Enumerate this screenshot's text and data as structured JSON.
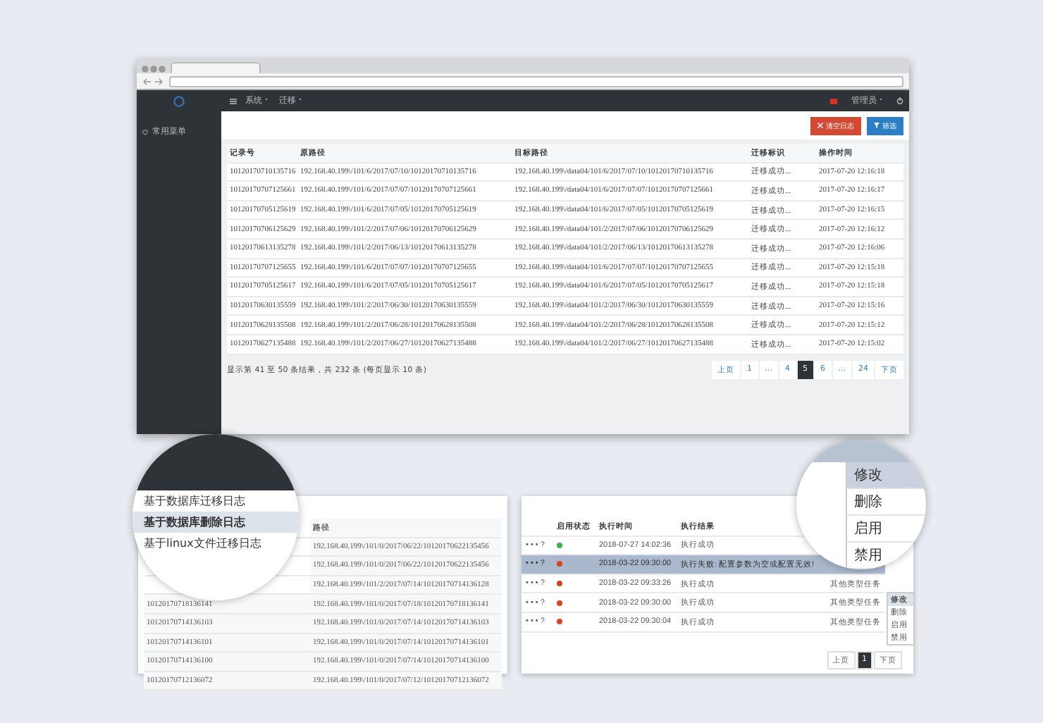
{
  "browser": {
    "menus": [
      "系统",
      "迁移"
    ],
    "user": "管理员",
    "sidebar": {
      "items": [
        {
          "label": "常用菜单"
        }
      ]
    },
    "toolbar": {
      "buttons": [
        {
          "label": "清空日志",
          "kind": "danger"
        },
        {
          "label": "筛选",
          "kind": "primary"
        }
      ]
    },
    "table": {
      "columns": [
        "记录号",
        "原路径",
        "目标路径",
        "迁移标识",
        "操作时间"
      ],
      "rows": [
        [
          "10120170710135716",
          "192.168.40.199\\/101/6/2017/07/10/10120170710135716",
          "192.168.40.199\\/data04/101/6/2017/07/10/10120170710135716",
          "迁移成功...",
          "2017-07-20 12:16:18"
        ],
        [
          "10120170707125661",
          "192.168.40.199\\/101/6/2017/07/07/10120170707125661",
          "192.168.40.199\\/data04/101/6/2017/07/07/10120170707125661",
          "迁移成功...",
          "2017-07-20 12:16:17"
        ],
        [
          "10120170705125619",
          "192.168.40.199\\/101/6/2017/07/05/10120170705125619",
          "192.168.40.199\\/data04/101/6/2017/07/05/10120170705125619",
          "迁移成功...",
          "2017-07-20 12:16:15"
        ],
        [
          "10120170706125629",
          "192.168.40.199\\/101/2/2017/07/06/10120170706125629",
          "192.168.40.199\\/data04/101/2/2017/07/06/10120170706125629",
          "迁移成功...",
          "2017-07-20 12:16:12"
        ],
        [
          "10120170613135278",
          "192.168.40.199\\/101/2/2017/06/13/10120170613135278",
          "192.168.40.199\\/data04/101/2/2017/06/13/10120170613135278",
          "迁移成功...",
          "2017-07-20 12:16:06"
        ],
        [
          "10120170707125655",
          "192.168.40.199\\/101/6/2017/07/07/10120170707125655",
          "192.168.40.199\\/data04/101/6/2017/07/07/10120170707125655",
          "迁移成功...",
          "2017-07-20 12:15:18"
        ],
        [
          "10120170705125617",
          "192.168.40.199\\/101/6/2017/07/05/10120170705125617",
          "192.168.40.199\\/data04/101/6/2017/07/05/10120170705125617",
          "迁移成功...",
          "2017-07-20 12:15:18"
        ],
        [
          "10120170630135559",
          "192.168.40.199\\/101/2/2017/06/30/10120170630135559",
          "192.168.40.199\\/data04/101/2/2017/06/30/10120170630135559",
          "迁移成功...",
          "2017-07-20 12:15:16"
        ],
        [
          "10120170628135508",
          "192.168.40.199\\/101/2/2017/06/28/10120170628135508",
          "192.168.40.199\\/data04/101/2/2017/06/28/10120170628135508",
          "迁移成功...",
          "2017-07-20 12:15:12"
        ],
        [
          "10120170627135488",
          "192.168.40.199\\/101/2/2017/06/27/10120170627135488",
          "192.168.40.199\\/data04/101/2/2017/06/27/10120170627135488",
          "迁移成功...",
          "2017-07-20 12:15:02"
        ]
      ]
    },
    "footer": "显示第 41 至 50 条结果，共 232 条 (每页显示 10 条)",
    "pagination": [
      {
        "label": "上页",
        "selected": false
      },
      {
        "label": "1",
        "selected": false
      },
      {
        "label": "…",
        "selected": false
      },
      {
        "label": "4",
        "selected": false
      },
      {
        "label": "5",
        "selected": true
      },
      {
        "label": "6",
        "selected": false
      },
      {
        "label": "…",
        "selected": false
      },
      {
        "label": "24",
        "selected": false
      },
      {
        "label": "下页",
        "selected": false
      }
    ]
  },
  "log_panel": {
    "menu": {
      "items": [
        {
          "label": "基于数据库迁移日志",
          "selected": false
        },
        {
          "label": "基于数据库删除日志",
          "selected": true
        },
        {
          "label": "基于linux文件迁移日志",
          "selected": false
        }
      ]
    },
    "table": {
      "columns": [
        "路径"
      ],
      "rows": [
        {
          "path": "192.168.40.199\\/101/0/2017/06/22/10120170622135456"
        },
        {
          "path": "192.168.40.199\\/101/0/2017/06/22/10120170622135456"
        },
        {
          "path": "192.168.40.199\\/101/2/2017/07/14/10120170714136128"
        },
        {
          "id": "10120170718136141",
          "path": "192.168.40.199\\/101/0/2017/07/18/10120170718136141"
        },
        {
          "id": "10120170714136103",
          "path": "192.168.40.199\\/101/0/2017/07/14/10120170714136103"
        },
        {
          "id": "10120170714136101",
          "path": "192.168.40.199\\/101/0/2017/07/14/10120170714136101"
        },
        {
          "id": "10120170714136100",
          "path": "192.168.40.199\\/101/0/2017/07/14/10120170714136100"
        },
        {
          "id": "10120170712136072",
          "path": "192.168.40.199\\/101/0/2017/07/12/10120170712136072"
        }
      ]
    }
  },
  "task_panel": {
    "table": {
      "columns": [
        "启用状态",
        "执行时间",
        "执行结果"
      ],
      "rows": [
        {
          "name": "• • • ?",
          "color": "#3cb44b",
          "time": "2018-07-27 14:02:36",
          "result": "执行成功",
          "selected": false
        },
        {
          "name": "• • • ?",
          "color": "#d9421e",
          "time": "2018-03-22 09:30:00",
          "result": "执行失败: 配置参数为空或配置无效!",
          "selected": true
        },
        {
          "name": "• • • ?",
          "color": "#d9421e",
          "time": "2018-03-22 09:33:26",
          "result": "执行成功",
          "type": "其他类型任务",
          "selected": false
        },
        {
          "name": "• • • ?",
          "color": "#d9421e",
          "time": "2018-03-22 09:30:00",
          "result": "执行成功",
          "type": "其他类型任务",
          "selected": false
        },
        {
          "name": "• • • ?",
          "color": "#d9421e",
          "time": "2018-03-22 09:30:04",
          "result": "执行成功",
          "type": "其他类型任务",
          "selected": false
        }
      ]
    },
    "action_menu": {
      "items": [
        {
          "label": "修改",
          "selected": true
        },
        {
          "label": "删除",
          "selected": false
        },
        {
          "label": "启用",
          "selected": false
        },
        {
          "label": "禁用",
          "selected": false
        }
      ]
    },
    "magnifier_menu": {
      "items": [
        {
          "label": "修改",
          "selected": true
        },
        {
          "label": "删除",
          "selected": false
        },
        {
          "label": "启用",
          "selected": false
        },
        {
          "label": "禁用",
          "selected": false
        }
      ]
    },
    "pagination": [
      {
        "label": "上页",
        "selected": false
      },
      {
        "label": "1",
        "selected": true
      },
      {
        "label": "下页",
        "selected": false
      }
    ]
  }
}
